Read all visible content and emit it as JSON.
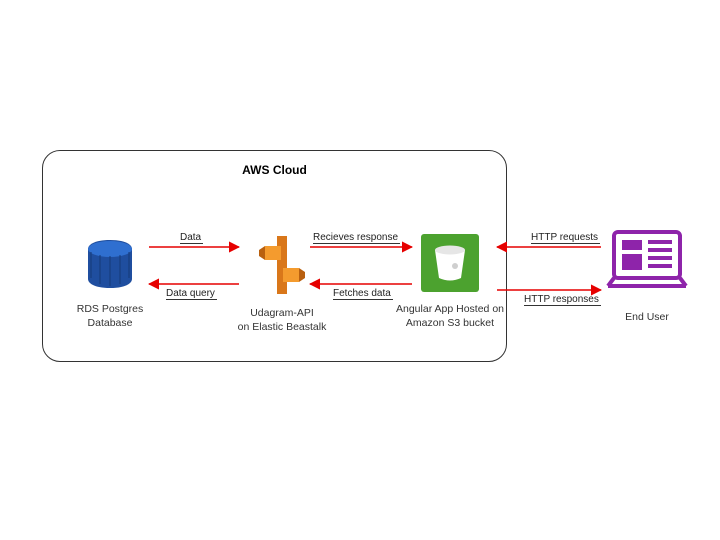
{
  "diagram": {
    "container_title": "AWS Cloud",
    "nodes": {
      "rds": {
        "caption_l1": "RDS Postgres",
        "caption_l2": "Database"
      },
      "api": {
        "caption_l1": "Udagram-API",
        "caption_l2": "on Elastic Beastalk"
      },
      "s3": {
        "caption_l1": "Angular App Hosted on",
        "caption_l2": "Amazon S3 bucket"
      },
      "user": {
        "caption_l1": "End User"
      }
    },
    "arrows": {
      "rds_to_api_top": "Data",
      "api_to_rds_bottom": "Data query",
      "api_to_s3_top": "Recieves response",
      "s3_to_api_bottom": "Fetches data",
      "user_to_s3_top": "HTTP requests",
      "s3_to_user_bottom": "HTTP responses"
    },
    "colors": {
      "arrow": "#e60000",
      "rds_blue_dark": "#1f4e9f",
      "rds_blue_light": "#2f6fd0",
      "eb_orange_dark": "#d9771a",
      "eb_orange_light": "#f49b2e",
      "s3_green": "#4ca22f",
      "user_purple": "#8e24aa"
    }
  }
}
